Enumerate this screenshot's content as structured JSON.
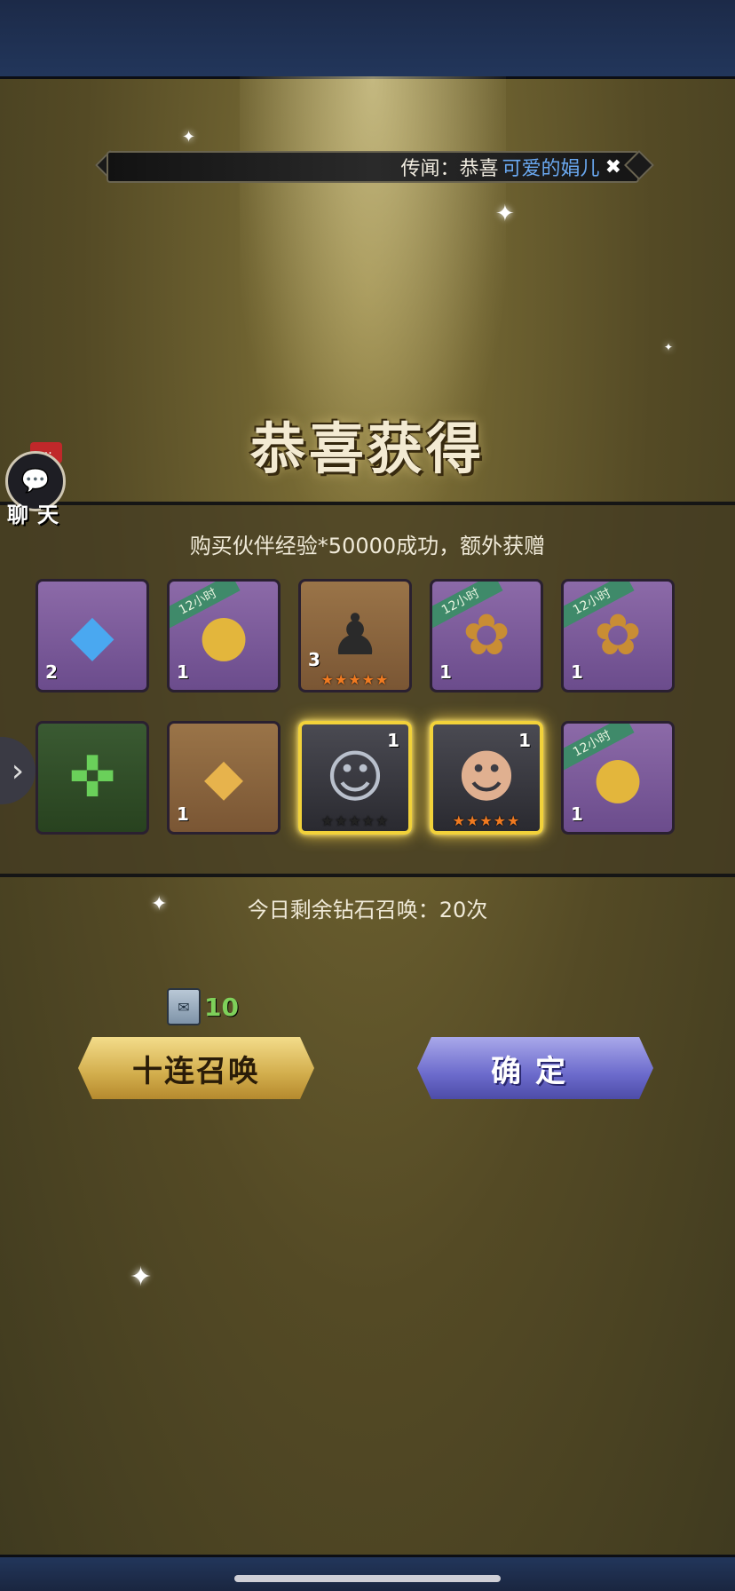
{
  "news": {
    "prefix": "传闻：恭喜",
    "player": "可爱的娟儿",
    "mark": "✖"
  },
  "title": "恭喜获得",
  "chat": {
    "label": "聊天",
    "badge": "..."
  },
  "message": "购买伙伴经验*50000成功，额外获赠",
  "items_row1": [
    {
      "name": "blue-gem",
      "qty": "2",
      "ribbon": "",
      "stars": ""
    },
    {
      "name": "gold-coins",
      "qty": "1",
      "ribbon": "12小时",
      "stars": ""
    },
    {
      "name": "hooded-figure-badge",
      "qty": "3",
      "ribbon": "",
      "stars": "★★★★★"
    },
    {
      "name": "gold-ore",
      "qty": "1",
      "ribbon": "12小时",
      "stars": ""
    },
    {
      "name": "gold-ore",
      "qty": "1",
      "ribbon": "12小时",
      "stars": ""
    }
  ],
  "items_row2": [
    {
      "name": "green-emblem",
      "qty": "",
      "ribbon": "",
      "stars": ""
    },
    {
      "name": "gold-crystal",
      "qty": "1",
      "ribbon": "",
      "stars": ""
    },
    {
      "name": "masked-hero",
      "qty": "1",
      "ribbon": "",
      "stars": "★★★★★"
    },
    {
      "name": "pirate-hero",
      "qty": "1",
      "ribbon": "",
      "stars": "★★★★★"
    },
    {
      "name": "gold-coins",
      "qty": "1",
      "ribbon": "12小时",
      "stars": ""
    }
  ],
  "remaining": "今日剩余钻石召唤：20次",
  "cost": "10",
  "buttons": {
    "ten_summon": "十连召唤",
    "confirm": "确定"
  },
  "colors": {
    "player": "#6aa8f0",
    "cost": "#7ed05a",
    "gold_button": "#d2ad4c",
    "blue_button": "#6c6bcc"
  }
}
